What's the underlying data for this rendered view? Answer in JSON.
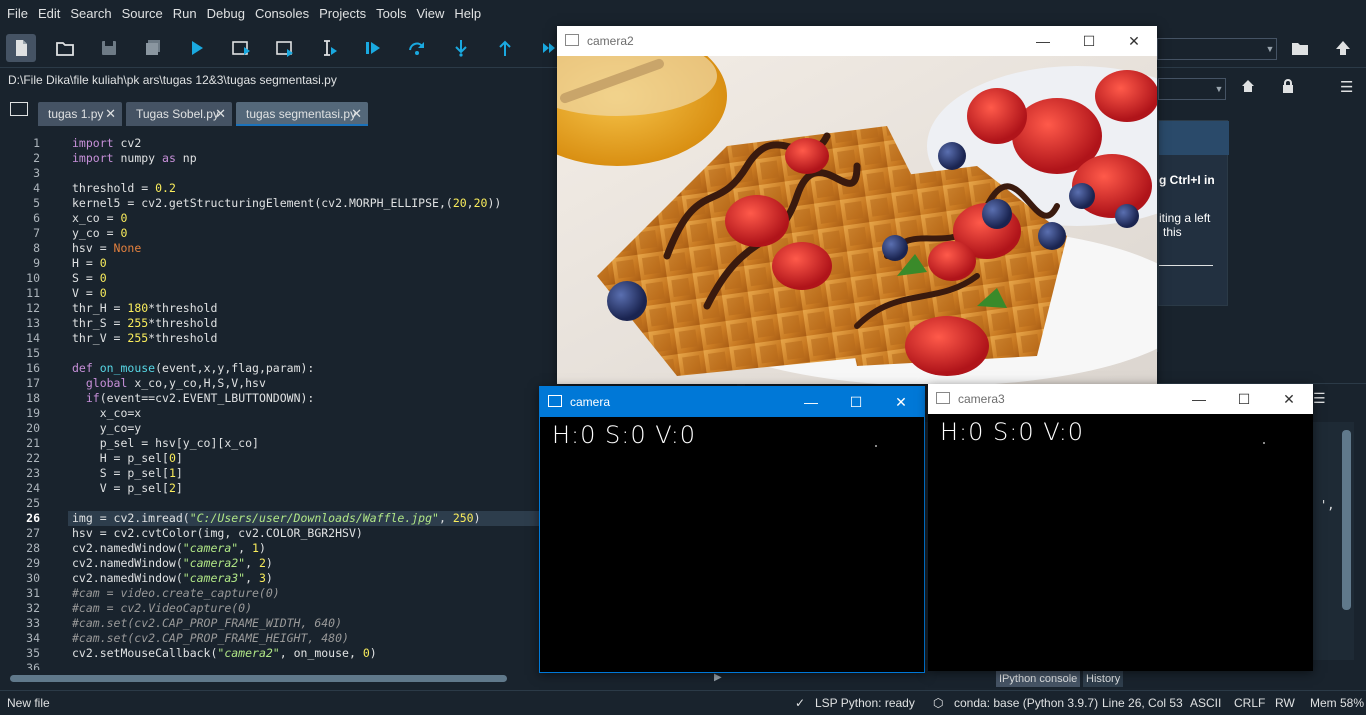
{
  "menu": [
    "File",
    "Edit",
    "Search",
    "Source",
    "Run",
    "Debug",
    "Consoles",
    "Projects",
    "Tools",
    "View",
    "Help"
  ],
  "path": "D:\\File Dika\\file kuliah\\pk ars\\tugas 12&3\\tugas segmentasi.py",
  "tabs": [
    {
      "label": "tugas 1.py"
    },
    {
      "label": "Tugas Sobel.py"
    },
    {
      "label": "tugas segmentasi.py"
    }
  ],
  "tab_close": "✕",
  "current_line": 26,
  "code_lines": [
    "import cv2",
    "import numpy as np",
    "",
    "threshold = 0.2",
    "kernel5 = cv2.getStructuringElement(cv2.MORPH_ELLIPSE,(20,20))",
    "x_co = 0",
    "y_co = 0",
    "hsv = None",
    "H = 0",
    "S = 0",
    "V = 0",
    "thr_H = 180*threshold",
    "thr_S = 255*threshold",
    "thr_V = 255*threshold",
    "",
    "def on_mouse(event,x,y,flag,param):",
    "  global x_co,y_co,H,S,V,hsv",
    "  if(event==cv2.EVENT_LBUTTONDOWN):",
    "    x_co=x",
    "    y_co=y",
    "    p_sel = hsv[y_co][x_co]",
    "    H = p_sel[0]",
    "    S = p_sel[1]",
    "    V = p_sel[2]",
    "",
    "img = cv2.imread(\"C:/Users/user/Downloads/Waffle.jpg\", 250)",
    "hsv = cv2.cvtColor(img, cv2.COLOR_BGR2HSV)",
    "cv2.namedWindow(\"camera\", 1)",
    "cv2.namedWindow(\"camera2\", 2)",
    "cv2.namedWindow(\"camera3\", 3)",
    "#cam = video.create_capture(0)",
    "#cam = cv2.VideoCapture(0)",
    "#cam.set(cv2.CAP_PROP_FRAME_WIDTH, 640)",
    "#cam.set(cv2.CAP_PROP_FRAME_HEIGHT, 480)",
    "cv2.setMouseCallback(\"camera2\", on_mouse, 0)",
    ""
  ],
  "help_panel": {
    "text1": "g Ctrl+I in",
    "text2": "iting a left",
    "text3": "this"
  },
  "console_tabs": {
    "ipython": "IPython console",
    "history": "History"
  },
  "console_trailing": "',",
  "windows": {
    "camera2": {
      "title": "camera2"
    },
    "camera": {
      "title": "camera",
      "hsv_text": "H:0  S:0  V:0"
    },
    "camera3": {
      "title": "camera3",
      "hsv_text": "H:0  S:0  V:0"
    }
  },
  "win_buttons": {
    "min": "—",
    "max": "☐",
    "close": "✕"
  },
  "status": {
    "left": "New file",
    "lsp": "LSP Python: ready",
    "conda": "conda: base (Python 3.9.7)",
    "position": "Line 26, Col 53",
    "encoding": "ASCII",
    "eol": "CRLF",
    "rw": "RW",
    "mem": "Mem 58%"
  },
  "colors": {
    "bg": "#19232d",
    "accent": "#1a72bb",
    "active_title": "#0078d7"
  }
}
